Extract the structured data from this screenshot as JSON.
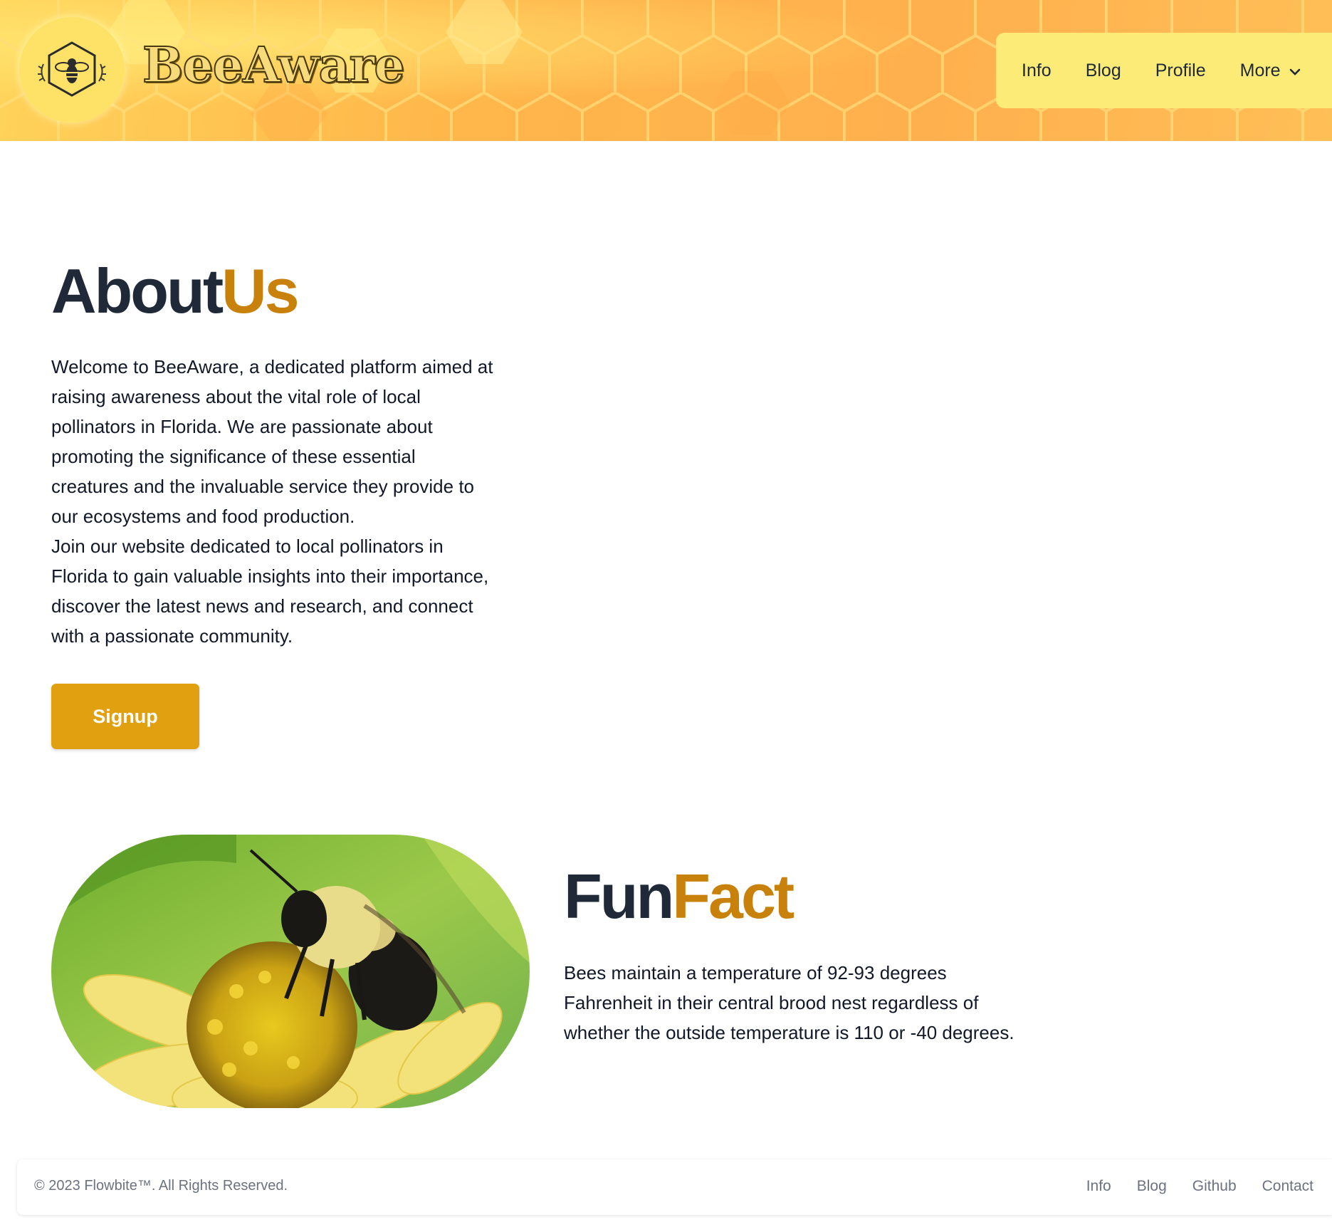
{
  "header": {
    "brand": "BeeAware",
    "logo_icon": "bee-hexagon-icon",
    "nav": [
      {
        "label": "Info"
      },
      {
        "label": "Blog"
      },
      {
        "label": "Profile"
      },
      {
        "label": "More",
        "icon": "chevron-down-icon"
      }
    ]
  },
  "about": {
    "title_part1": "About",
    "title_part2": "Us",
    "paragraph1": "Welcome to BeeAware, a dedicated platform aimed at raising awareness about the vital role of local pollinators in Florida. We are passionate about promoting the significance of these essential creatures and the invaluable service they provide to our ecosystems and food production.",
    "paragraph2": "Join our website dedicated to local pollinators in Florida to gain valuable insights into their importance, discover the latest news and research, and connect with a passionate community.",
    "signup_label": "Signup"
  },
  "funfact": {
    "image": "bumblebee-on-yellow-flower",
    "title_part1": "Fun",
    "title_part2": "Fact",
    "text": "Bees maintain a temperature of 92-93 degrees Fahrenheit in their central brood nest regardless of whether the outside temperature is 110 or -40 degrees."
  },
  "footer": {
    "copyright": "© 2023 Flowbite™. All Rights Reserved.",
    "links": [
      {
        "label": "Info"
      },
      {
        "label": "Blog"
      },
      {
        "label": "Github"
      },
      {
        "label": "Contact"
      }
    ]
  },
  "colors": {
    "header_bg": "#ffb64a",
    "nav_bg": "#fdeb78",
    "accent_gold": "#c8820c",
    "button_bg": "#e0a010",
    "heading_dark": "#1f2937"
  }
}
